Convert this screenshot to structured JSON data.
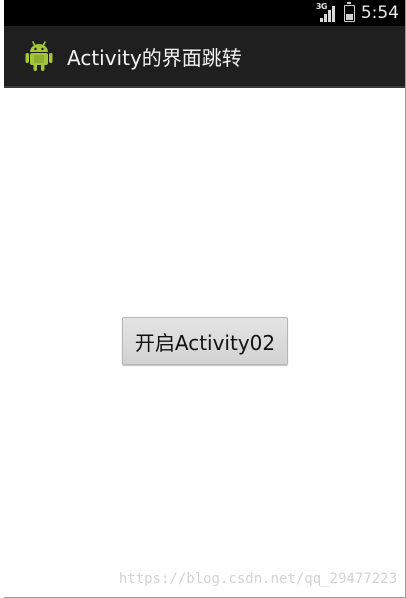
{
  "status_bar": {
    "network_type": "3G",
    "time": "5:54",
    "icons": [
      "signal-icon",
      "battery-icon"
    ]
  },
  "action_bar": {
    "title": "Activity的界面跳转",
    "icon": "android-icon"
  },
  "main": {
    "start_button_label": "开启Activity02"
  },
  "watermark": {
    "text": "https://blog.csdn.net/qq_29477223"
  },
  "colors": {
    "status_bar_bg": "#000000",
    "action_bar_bg": "#1f1f1f",
    "android_green": "#a4c639",
    "button_bg": "#dcdcdc"
  }
}
